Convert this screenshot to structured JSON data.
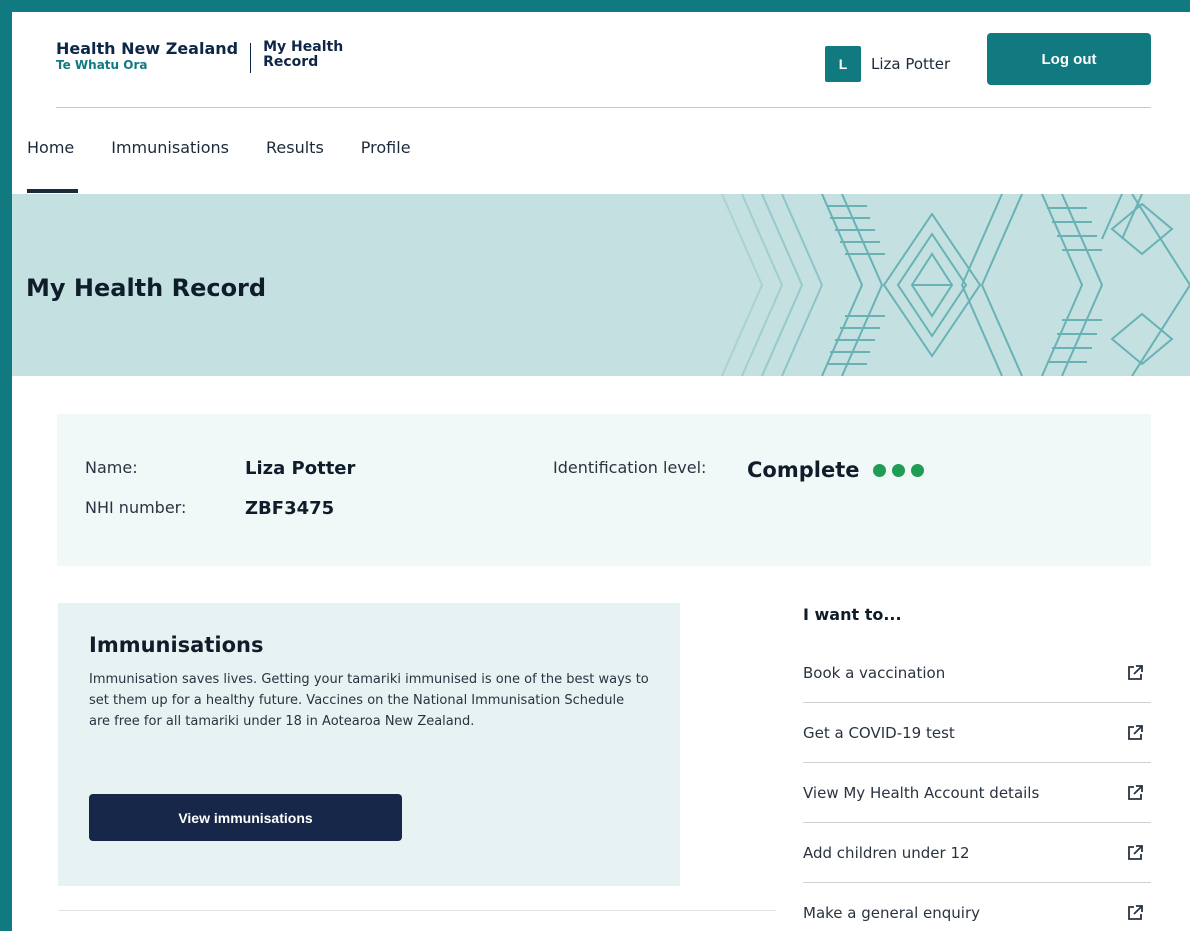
{
  "header": {
    "brand_main": "Health New Zealand",
    "brand_sub": "Te Whatu Ora",
    "app_line1": "My Health",
    "app_line2": "Record",
    "user_initial": "L",
    "user_name": "Liza Potter",
    "logout_label": "Log out"
  },
  "nav": {
    "items": [
      {
        "label": "Home",
        "active": true
      },
      {
        "label": "Immunisations"
      },
      {
        "label": "Results"
      },
      {
        "label": "Profile"
      }
    ]
  },
  "banner": {
    "title": "My Health Record"
  },
  "identity": {
    "name_label": "Name:",
    "name_value": "Liza Potter",
    "nhi_label": "NHI number:",
    "nhi_value": "ZBF3475",
    "id_level_label": "Identification level:",
    "id_level_value": "Complete",
    "id_level_dots": 3,
    "dot_color": "#1f9d55"
  },
  "immunisations": {
    "title": "Immunisations",
    "body": "Immunisation saves lives. Getting your tamariki immunised is one of the best ways to set them up for a healthy future. Vaccines on the National Immunisation Schedule are free for all tamariki under 18 in Aotearoa New Zealand.",
    "button_label": "View immunisations"
  },
  "i_want_to": {
    "title": "I want to...",
    "items": [
      {
        "label": "Book a vaccination",
        "icon": "external-link-icon"
      },
      {
        "label": "Get a COVID-19 test",
        "icon": "external-link-icon"
      },
      {
        "label": "View My Health Account details",
        "icon": "external-link-icon"
      },
      {
        "label": "Add children under 12",
        "icon": "external-link-icon"
      },
      {
        "label": "Make a general enquiry",
        "icon": "external-link-icon"
      }
    ]
  },
  "colors": {
    "frame": "#117a80",
    "accent": "#117a80",
    "navy": "#172749",
    "banner_bg": "#c5e0e1"
  }
}
